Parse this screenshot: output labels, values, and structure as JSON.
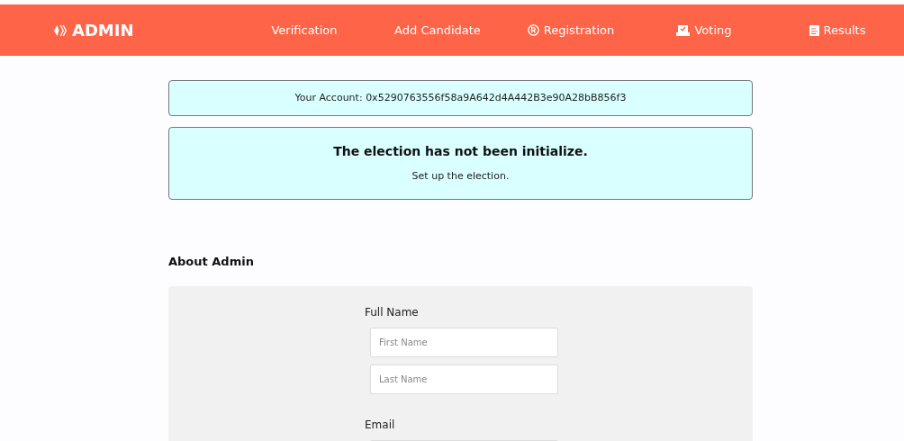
{
  "navbar": {
    "brand": "ADMIN",
    "items": [
      {
        "label": "Verification",
        "kind": "plain"
      },
      {
        "label": "Add Candidate",
        "kind": "plain"
      },
      {
        "label": "Registration",
        "kind": "registered"
      },
      {
        "label": "Voting",
        "kind": "ballot"
      },
      {
        "label": "Results",
        "kind": "document"
      }
    ]
  },
  "account": {
    "label": "Your Account:",
    "address": "0x5290763556f58a9A642d4A442B3e90A28bB856f3"
  },
  "notice": {
    "title": "The election has not been initialize.",
    "message": "Set up the election."
  },
  "section_title": "About Admin",
  "form": {
    "fields": [
      {
        "label": "Full Name",
        "inputs": [
          {
            "kind": "text",
            "placeholder": "First Name"
          },
          {
            "kind": "text",
            "placeholder": "Last Name"
          }
        ]
      },
      {
        "label": "Email",
        "inputs": [
          {
            "kind": "text"
          }
        ]
      }
    ]
  }
}
